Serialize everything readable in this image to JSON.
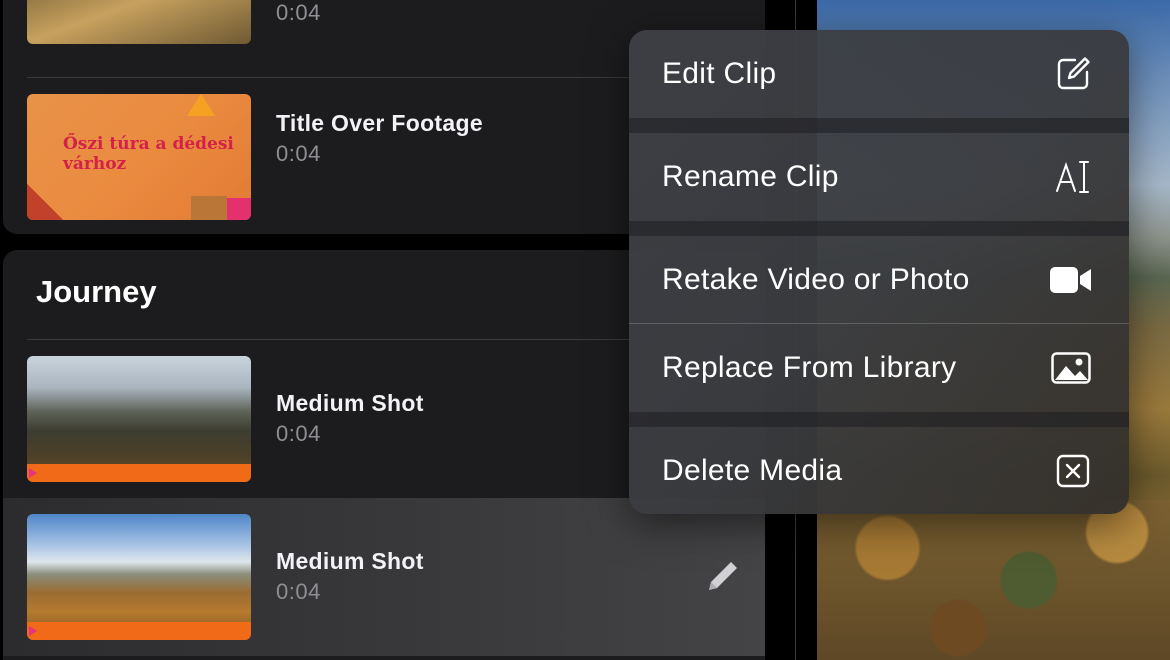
{
  "top_section": {
    "clips": [
      {
        "title": "",
        "duration": "0:04"
      },
      {
        "title": "Title Over Footage",
        "duration": "0:04",
        "thumb_text": "Őszi túra a dédesi várhoz"
      }
    ]
  },
  "journey_section": {
    "title": "Journey",
    "clips": [
      {
        "title": "Medium Shot",
        "duration": "0:04"
      },
      {
        "title": "Medium Shot",
        "duration": "0:04",
        "selected": true
      }
    ]
  },
  "context_menu": {
    "items": [
      {
        "label": "Edit Clip",
        "icon": "edit-square-icon"
      },
      {
        "label": "Rename Clip",
        "icon": "text-cursor-icon"
      },
      {
        "label": "Retake Video or Photo",
        "icon": "video-camera-icon"
      },
      {
        "label": "Replace From Library",
        "icon": "photo-icon"
      },
      {
        "label": "Delete Media",
        "icon": "delete-box-icon"
      }
    ]
  },
  "colors": {
    "panel_bg": "#1c1c1e",
    "accent_orange": "#f06a18",
    "duration_gray": "#8e8e93"
  }
}
